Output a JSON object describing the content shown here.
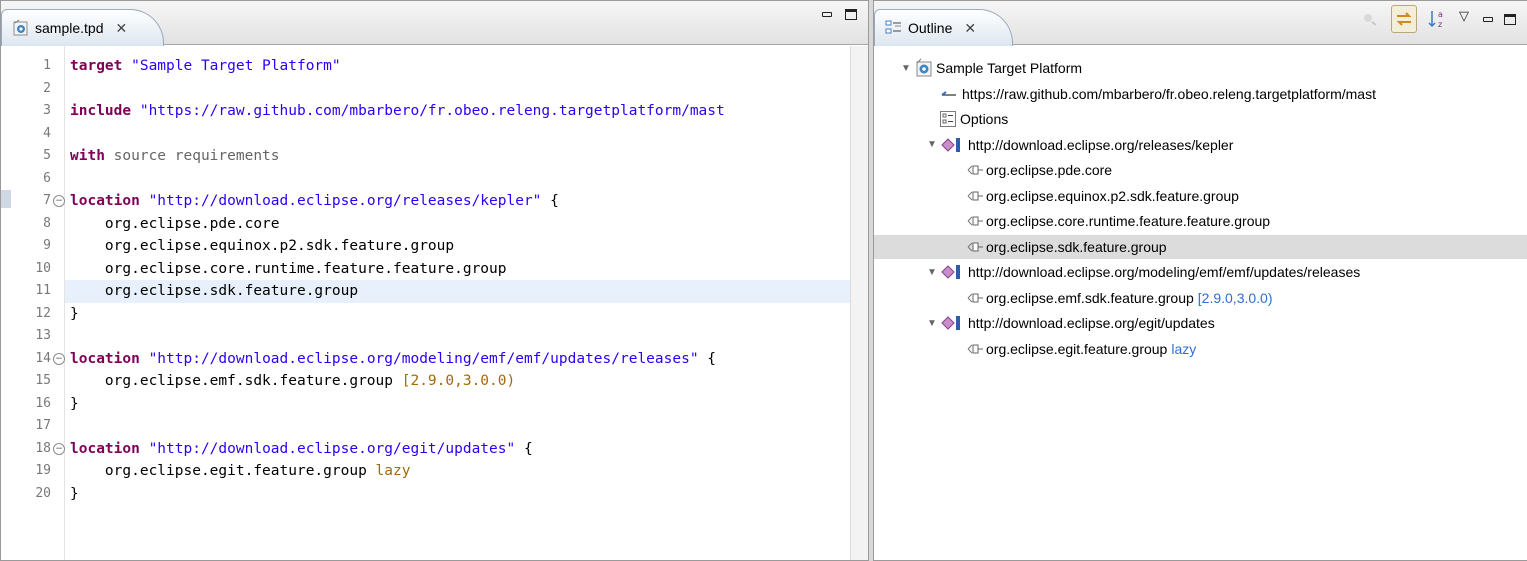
{
  "editor": {
    "tab_label": "sample.tpd",
    "tab_close": "✕",
    "lines": [
      {
        "n": "1",
        "seg": [
          {
            "t": "target ",
            "c": "kw"
          },
          {
            "t": "\"Sample Target Platform\"",
            "c": "str"
          }
        ]
      },
      {
        "n": "2",
        "seg": []
      },
      {
        "n": "3",
        "seg": [
          {
            "t": "include ",
            "c": "kw"
          },
          {
            "t": "\"https://raw.github.com/mbarbero/fr.obeo.releng.targetplatform/mast",
            "c": "str"
          }
        ]
      },
      {
        "n": "4",
        "seg": []
      },
      {
        "n": "5",
        "seg": [
          {
            "t": "with ",
            "c": "kw"
          },
          {
            "t": "source requirements",
            "c": "mod"
          }
        ]
      },
      {
        "n": "6",
        "seg": []
      },
      {
        "n": "7",
        "fold": true,
        "seg": [
          {
            "t": "location ",
            "c": "kw"
          },
          {
            "t": "\"http://download.eclipse.org/releases/kepler\"",
            "c": "str"
          },
          {
            "t": " {",
            "c": ""
          }
        ]
      },
      {
        "n": "8",
        "seg": [
          {
            "t": "    org.eclipse.pde.core",
            "c": ""
          }
        ]
      },
      {
        "n": "9",
        "seg": [
          {
            "t": "    org.eclipse.equinox.p2.sdk.feature.group",
            "c": ""
          }
        ]
      },
      {
        "n": "10",
        "seg": [
          {
            "t": "    org.eclipse.core.runtime.feature.feature.group",
            "c": ""
          }
        ]
      },
      {
        "n": "11",
        "seg": [
          {
            "t": "    org.eclipse.sdk.feature.group",
            "c": ""
          }
        ]
      },
      {
        "n": "12",
        "seg": [
          {
            "t": "}",
            "c": ""
          }
        ]
      },
      {
        "n": "13",
        "seg": []
      },
      {
        "n": "14",
        "fold": true,
        "seg": [
          {
            "t": "location ",
            "c": "kw"
          },
          {
            "t": "\"http://download.eclipse.org/modeling/emf/emf/updates/releases\"",
            "c": "str"
          },
          {
            "t": " {",
            "c": ""
          }
        ]
      },
      {
        "n": "15",
        "seg": [
          {
            "t": "    org.eclipse.emf.sdk.feature.group ",
            "c": ""
          },
          {
            "t": "[2.9.0,3.0.0)",
            "c": "ver"
          }
        ]
      },
      {
        "n": "16",
        "seg": [
          {
            "t": "}",
            "c": ""
          }
        ]
      },
      {
        "n": "17",
        "seg": []
      },
      {
        "n": "18",
        "fold": true,
        "seg": [
          {
            "t": "location ",
            "c": "kw"
          },
          {
            "t": "\"http://download.eclipse.org/egit/updates\"",
            "c": "str"
          },
          {
            "t": " {",
            "c": ""
          }
        ]
      },
      {
        "n": "19",
        "seg": [
          {
            "t": "    org.eclipse.egit.feature.group ",
            "c": ""
          },
          {
            "t": "lazy",
            "c": "ver"
          }
        ]
      },
      {
        "n": "20",
        "seg": [
          {
            "t": "}",
            "c": ""
          }
        ]
      }
    ]
  },
  "outline": {
    "tab_label": "Outline",
    "tab_close": "✕",
    "nodes": [
      {
        "depth": 0,
        "tw": "▼",
        "icon": "root",
        "text": "Sample Target Platform"
      },
      {
        "depth": 1,
        "tw": "",
        "icon": "inc",
        "text": "https://raw.github.com/mbarbero/fr.obeo.releng.targetplatform/mast"
      },
      {
        "depth": 1,
        "tw": "",
        "icon": "opt",
        "text": "Options"
      },
      {
        "depth": 1,
        "tw": "▼",
        "icon": "loc",
        "text": "http://download.eclipse.org/releases/kepler"
      },
      {
        "depth": 2,
        "tw": "",
        "icon": "unit",
        "text": "org.eclipse.pde.core"
      },
      {
        "depth": 2,
        "tw": "",
        "icon": "unit",
        "text": "org.eclipse.equinox.p2.sdk.feature.group"
      },
      {
        "depth": 2,
        "tw": "",
        "icon": "unit",
        "text": "org.eclipse.core.runtime.feature.feature.group"
      },
      {
        "depth": 2,
        "tw": "",
        "icon": "unit",
        "text": "org.eclipse.sdk.feature.group",
        "selected": true
      },
      {
        "depth": 1,
        "tw": "▼",
        "icon": "loc",
        "text": "http://download.eclipse.org/modeling/emf/emf/updates/releases"
      },
      {
        "depth": 2,
        "tw": "",
        "icon": "unit",
        "text": "org.eclipse.emf.sdk.feature.group",
        "extra": "[2.9.0,3.0.0)"
      },
      {
        "depth": 1,
        "tw": "▼",
        "icon": "loc",
        "text": "http://download.eclipse.org/egit/updates"
      },
      {
        "depth": 2,
        "tw": "",
        "icon": "unit",
        "text": "org.eclipse.egit.feature.group",
        "extra": "lazy"
      }
    ]
  },
  "colors": {
    "keyword": "#7f0055",
    "string": "#2a00ff",
    "version": "#a06b0b",
    "outline_extra": "#2e6fd1",
    "selection": "#dcdcdc"
  }
}
